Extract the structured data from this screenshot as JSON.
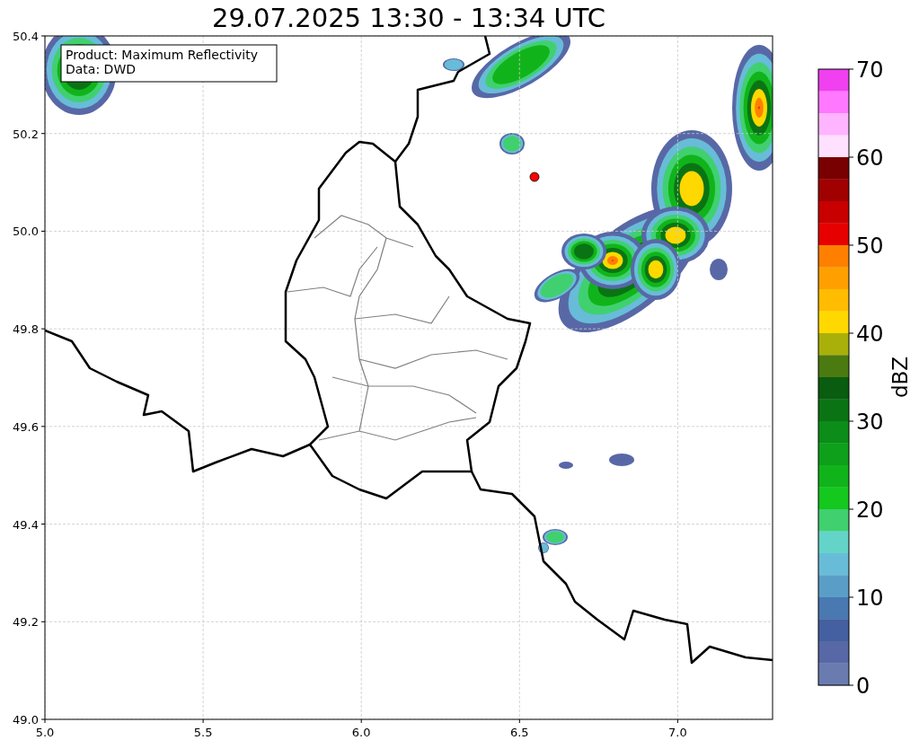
{
  "title": "29.07.2025 13:30 - 13:34 UTC",
  "map": {
    "annotation": [
      "Product: Maximum Reflectivity",
      "Data: DWD"
    ],
    "grid": true,
    "y_tick_labels": [
      "50.4",
      "50.2",
      "50.0",
      "49.8",
      "49.6",
      "49.4",
      "49.2",
      "49.0"
    ],
    "x_tick_labels": [
      "5.0",
      "5.5",
      "6.0",
      "6.5",
      "7.0"
    ]
  },
  "colorbar": {
    "ticks": [
      "70",
      "60",
      "50",
      "40",
      "30",
      "20",
      "10",
      "0"
    ],
    "bins": [
      {
        "color": "#f040f0"
      },
      {
        "color": "#ff78ff"
      },
      {
        "color": "#ffb4ff"
      },
      {
        "color": "#ffe0ff"
      },
      {
        "color": "#780000"
      },
      {
        "color": "#a00000"
      },
      {
        "color": "#c80000"
      },
      {
        "color": "#e60000"
      },
      {
        "color": "#ff8000"
      },
      {
        "color": "#ffa000"
      },
      {
        "color": "#ffbc00"
      },
      {
        "color": "#ffd800"
      },
      {
        "color": "#aab00a"
      },
      {
        "color": "#4a7a10"
      },
      {
        "color": "#0a5c10"
      },
      {
        "color": "#0a7414"
      },
      {
        "color": "#0c8c18"
      },
      {
        "color": "#0ea01a"
      },
      {
        "color": "#10b41a"
      },
      {
        "color": "#14c81e"
      },
      {
        "color": "#40d070"
      },
      {
        "color": "#64d4c8"
      },
      {
        "color": "#68bcd8"
      },
      {
        "color": "#5a9ec8"
      },
      {
        "color": "#4a78b0"
      },
      {
        "color": "#4460a0"
      },
      {
        "color": "#5868a6"
      },
      {
        "color": "#6a7caf"
      }
    ],
    "label": "dBZ"
  }
}
